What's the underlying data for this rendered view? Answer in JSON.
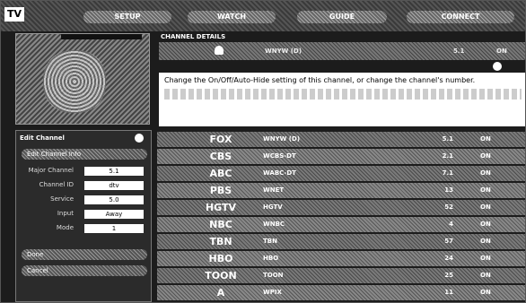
{
  "brand": {
    "logo_text": "TV"
  },
  "tabs": [
    {
      "label": "SETUP",
      "left": 0
    },
    {
      "label": "WATCH",
      "left": 0
    },
    {
      "label": "GUIDE",
      "left": 0
    },
    {
      "label": "CONNECT",
      "left": 0
    }
  ],
  "info": {
    "title": "CHANNEL DETAILS",
    "row_call": "WNYW (D)",
    "row_num": "5.1",
    "row_on": "ON",
    "description": "Change the On/Off/Auto-Hide setting of this channel, or change the channel's number."
  },
  "settings": {
    "title": "Edit Channel",
    "top_button": "Edit Channel Info",
    "fields": [
      {
        "label": "Major Channel",
        "value": "5.1"
      },
      {
        "label": "Channel ID",
        "value": "dtv"
      },
      {
        "label": "Service",
        "value": "5.0"
      },
      {
        "label": "Input",
        "value": "Away"
      },
      {
        "label": "Mode",
        "value": "1"
      }
    ],
    "buttons": [
      "Done",
      "Cancel"
    ]
  },
  "channels": [
    {
      "logo": "FOX",
      "call": "WNYW (D)",
      "num": "5.1",
      "state": "ON"
    },
    {
      "logo": "CBS",
      "call": "WCBS-DT",
      "num": "2.1",
      "state": "ON"
    },
    {
      "logo": "ABC",
      "call": "WABC-DT",
      "num": "7.1",
      "state": "ON"
    },
    {
      "logo": "PBS",
      "call": "WNET",
      "num": "13",
      "state": "ON"
    },
    {
      "logo": "HGTV",
      "call": "HGTV",
      "num": "52",
      "state": "ON"
    },
    {
      "logo": "NBC",
      "call": "WNBC",
      "num": "4",
      "state": "ON"
    },
    {
      "logo": "TBN",
      "call": "TBN",
      "num": "57",
      "state": "ON"
    },
    {
      "logo": "HBO",
      "call": "HBO",
      "num": "24",
      "state": "ON"
    },
    {
      "logo": "TOON",
      "call": "TOON",
      "num": "25",
      "state": "ON"
    },
    {
      "logo": "A",
      "call": "WPIX",
      "num": "11",
      "state": "ON"
    }
  ]
}
